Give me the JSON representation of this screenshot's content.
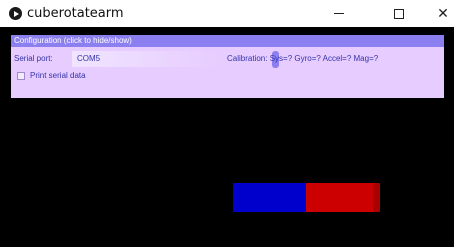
{
  "window": {
    "title": "cuberotatearm",
    "minimize_glyph": "—",
    "maximize_glyph": "☐",
    "close_glyph": "✕"
  },
  "config": {
    "header": "Configuration (click to hide/show)",
    "serial_label": "Serial port:",
    "serial_value": "COM5",
    "calibration": "Calibration: Sys=? Gyro=? Accel=? Mag=?",
    "print_label": "Print serial data",
    "print_checked": false
  },
  "colors": {
    "header_bg": "#8c7ff0",
    "panel_bg": "#e7ccff",
    "text": "#3333aa",
    "cube_blue": "#0000cc",
    "cube_red": "#cc0000"
  },
  "icons": [
    "app-play-icon",
    "minimize-icon",
    "maximize-icon",
    "close-icon",
    "spinner-icon"
  ]
}
